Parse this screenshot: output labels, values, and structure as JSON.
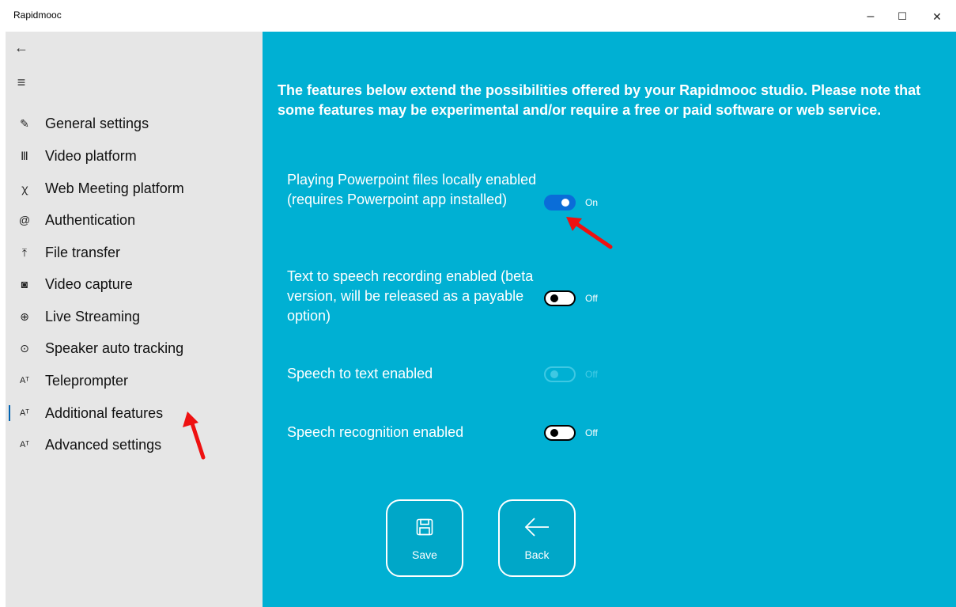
{
  "window": {
    "title": "Rapidmooc",
    "minimize": "–",
    "maximize": "☐",
    "close": "✕"
  },
  "sidebar": {
    "back_icon": "←",
    "menu_icon": "≡",
    "items": [
      {
        "label": "General settings",
        "icon": "✎",
        "icon_name": "wrench-icon"
      },
      {
        "label": "Video platform",
        "icon": "Ⅲ",
        "icon_name": "library-icon"
      },
      {
        "label": "Web Meeting platform",
        "icon": "ꭓ",
        "icon_name": "people-icon"
      },
      {
        "label": "Authentication",
        "icon": "@",
        "icon_name": "at-icon"
      },
      {
        "label": "File transfer",
        "icon": "⤒",
        "icon_name": "upload-icon"
      },
      {
        "label": "Video capture",
        "icon": "◙",
        "icon_name": "camera-icon"
      },
      {
        "label": "Live Streaming",
        "icon": "⊕",
        "icon_name": "globe-icon"
      },
      {
        "label": "Speaker auto tracking",
        "icon": "⊙",
        "icon_name": "target-icon"
      },
      {
        "label": "Teleprompter",
        "icon": "Aᵀ",
        "icon_name": "text-icon"
      },
      {
        "label": "Additional features",
        "icon": "Aᵀ",
        "icon_name": "text-icon"
      },
      {
        "label": "Advanced settings",
        "icon": "Aᵀ",
        "icon_name": "text-icon"
      }
    ],
    "active_index": 9
  },
  "main": {
    "intro": "The features below extend the possibilities offered by your Rapidmooc studio. Please note that some features may be experimental and/or require a free or paid software or web service.",
    "settings": [
      {
        "label": "Playing Powerpoint files locally enabled (requires Powerpoint app installed)",
        "state": "On",
        "enabled": true,
        "disabled": false
      },
      {
        "label": "Text to speech recording enabled (beta version, will be released as a payable option)",
        "state": "Off",
        "enabled": false,
        "disabled": false
      },
      {
        "label": "Speech to text enabled",
        "state": "Off",
        "enabled": false,
        "disabled": true
      },
      {
        "label": "Speech recognition enabled",
        "state": "Off",
        "enabled": false,
        "disabled": false
      }
    ],
    "buttons": {
      "save": "Save",
      "back": "Back"
    }
  },
  "colors": {
    "main_bg": "#00b0d3",
    "sidebar_bg": "#e6e6e6",
    "toggle_on": "#0a6dd8",
    "annotation_arrow": "#ee1111"
  }
}
